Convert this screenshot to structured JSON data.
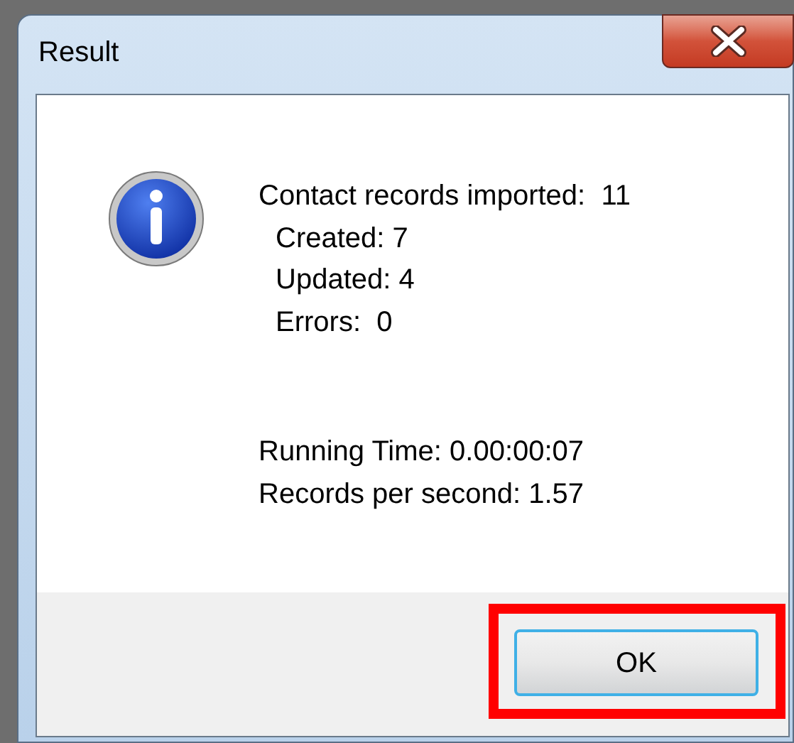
{
  "window": {
    "title": "Result"
  },
  "summary": [
    {
      "text": "Contact records imported:  11",
      "indent": false
    },
    {
      "text": "Created: 7",
      "indent": true
    },
    {
      "text": "Updated: 4",
      "indent": true
    },
    {
      "text": "Errors:  0",
      "indent": true
    }
  ],
  "timing": [
    "Running Time: 0.00:00:07",
    "Records per second: 1.57"
  ],
  "buttons": [
    {
      "label": "OK",
      "highlighted": true
    }
  ]
}
